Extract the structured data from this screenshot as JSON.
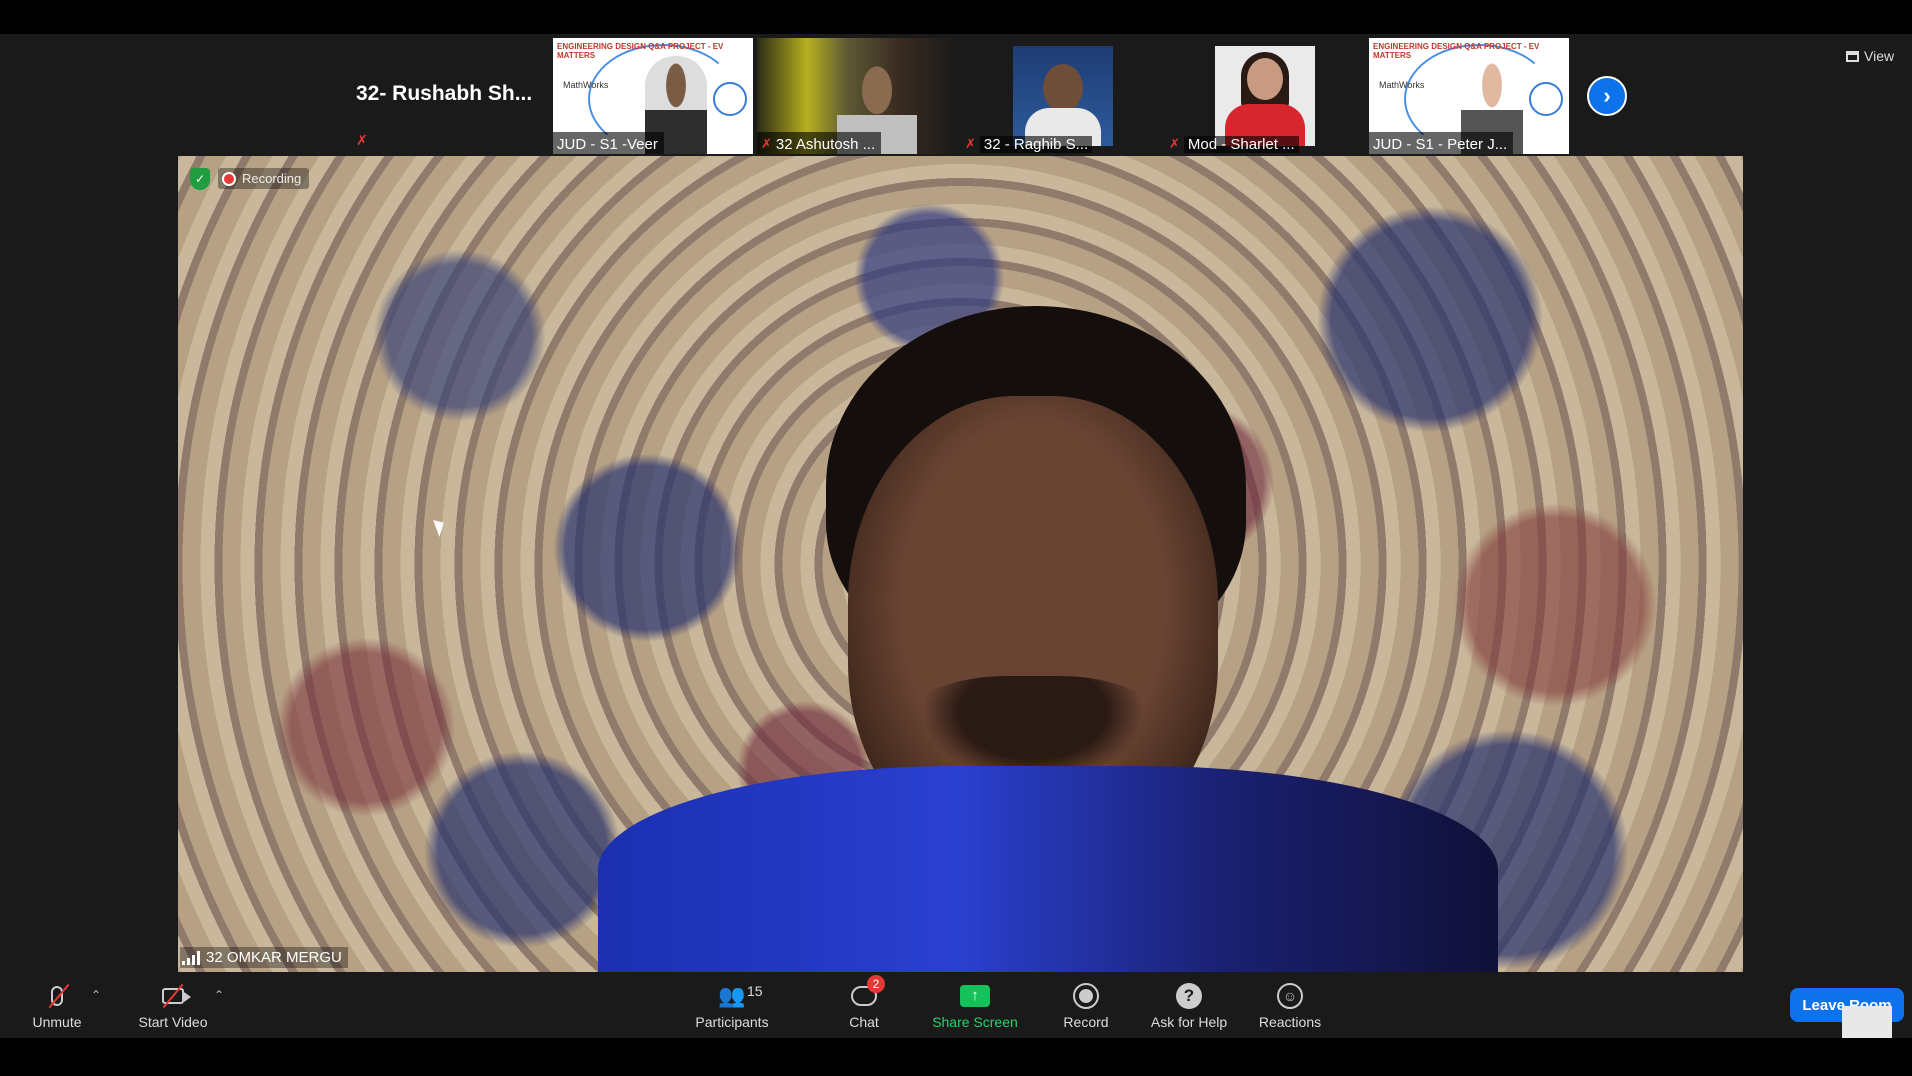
{
  "filmstrip": {
    "active_speaker_name": "32- Rushabh Sh...",
    "tiles": [
      {
        "label": "JUD - S1 -Veer",
        "muted": false,
        "poster_title": "ENGINEERING DESIGN Q&A PROJECT - EV MATTERS",
        "poster_brand": "MathWorks"
      },
      {
        "label": "32 Ashutosh ...",
        "muted": true
      },
      {
        "label": "32 - Raghib S...",
        "muted": true
      },
      {
        "label": "Mod - Sharlet ...",
        "muted": true
      },
      {
        "label": "JUD - S1 - Peter J...",
        "muted": false,
        "poster_title": "ENGINEERING DESIGN Q&A PROJECT - EV MATTERS",
        "poster_brand": "MathWorks"
      }
    ],
    "next_icon": "chevron-right-icon"
  },
  "view": {
    "label": "View"
  },
  "main_video": {
    "recording_label": "Recording",
    "speaker_name": "32 OMKAR MERGU"
  },
  "toolbar": {
    "unmute_label": "Unmute",
    "start_video_label": "Start Video",
    "participants_label": "Participants",
    "participants_count": "15",
    "chat_label": "Chat",
    "chat_badge": "2",
    "share_screen_label": "Share Screen",
    "record_label": "Record",
    "ask_for_help_label": "Ask for Help",
    "reactions_label": "Reactions",
    "leave_label": "Leave Room"
  },
  "colors": {
    "accent": "#0e72ed",
    "share_green": "#16c15c",
    "muted_red": "#e53935"
  }
}
